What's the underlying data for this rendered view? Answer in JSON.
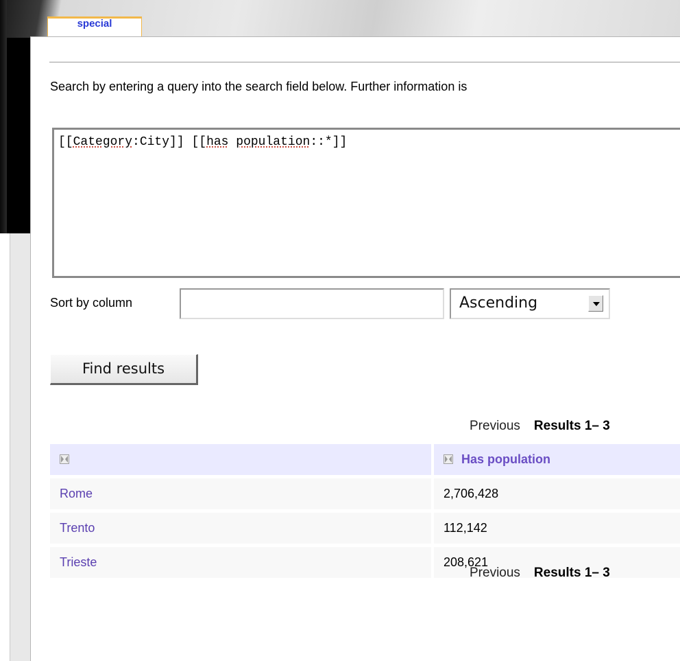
{
  "tab": {
    "label": "special"
  },
  "intro": {
    "text": "Search by entering a query into the search field below. Further information is"
  },
  "query": {
    "parts": [
      {
        "t": "[[",
        "u": false
      },
      {
        "t": "Category",
        "u": true
      },
      {
        "t": ":City]] [[",
        "u": false
      },
      {
        "t": "has",
        "u": true
      },
      {
        "t": " ",
        "u": false
      },
      {
        "t": "population",
        "u": true
      },
      {
        "t": "::*]]",
        "u": false
      }
    ]
  },
  "sort": {
    "label": "Sort by column",
    "input_value": "",
    "order_value": "Ascending"
  },
  "find_button": {
    "label": "Find results"
  },
  "pager": {
    "previous": "Previous",
    "results": "Results 1– 3"
  },
  "table": {
    "headers": [
      "",
      "Has population"
    ],
    "rows": [
      {
        "name": "Rome",
        "population": "2,706,428"
      },
      {
        "name": "Trento",
        "population": "112,142"
      },
      {
        "name": "Trieste",
        "population": "208,621"
      }
    ]
  },
  "colors": {
    "tab_border": "#f2b84a",
    "tab_text": "#2a3bd6",
    "link": "#5a3fb0",
    "header_bg": "#eaeaff",
    "row_bg": "#f8f8f8"
  }
}
